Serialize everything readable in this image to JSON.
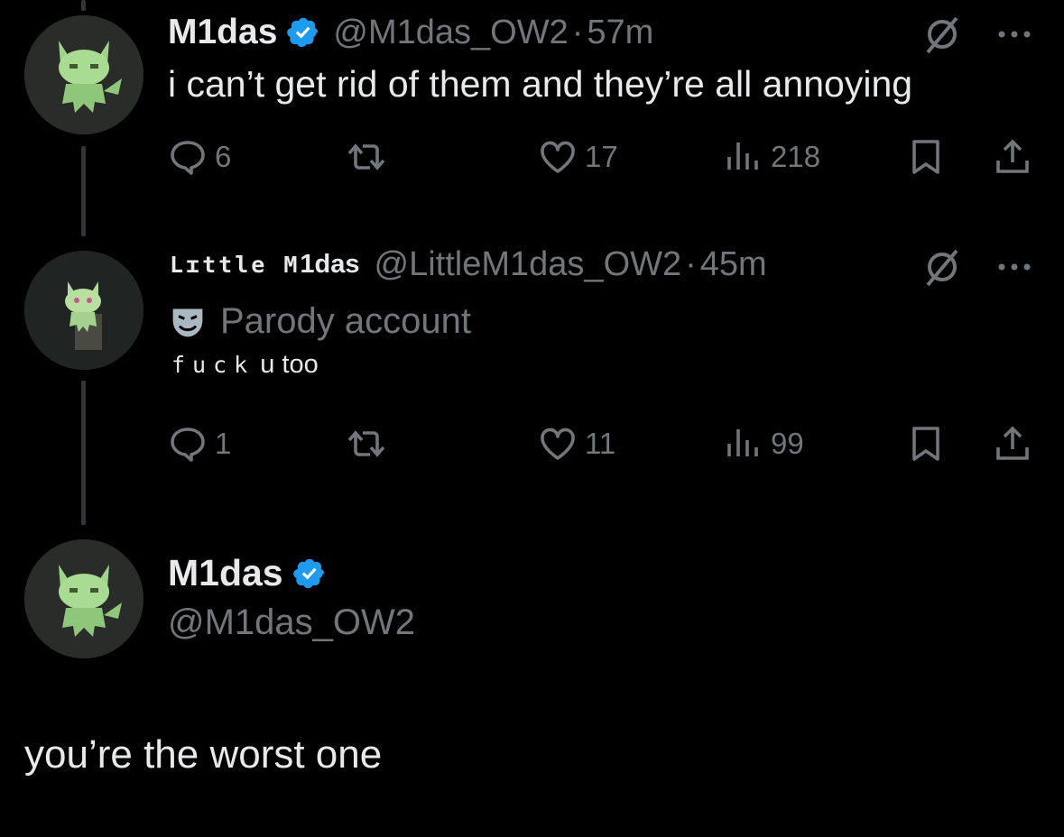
{
  "colors": {
    "background": "#000000",
    "text": "#e7e9ea",
    "muted": "#71767b",
    "verified": "#1d9bf0",
    "thread_line": "#333639"
  },
  "tweet1": {
    "name": "M1das",
    "handle": "@M1das_OW2",
    "separator": "·",
    "time": "57m",
    "verified_icon": "verified-badge-icon",
    "text": "i can’t get rid of them and they’re all annoying",
    "actions": {
      "replies": "6",
      "likes": "17",
      "views": "218"
    }
  },
  "tweet2": {
    "name_stylized": "Lɪttle M",
    "name_bold": "1das",
    "handle": "@LittleM1das_OW2",
    "separator": "·",
    "time": "45m",
    "parody_label": "Parody account",
    "parody_icon": "theater-mask-icon",
    "text_stylized": "fuck",
    "text_plain": "u too",
    "actions": {
      "replies": "1",
      "likes": "11",
      "views": "99"
    }
  },
  "composer": {
    "name": "M1das",
    "handle": "@M1das_OW2",
    "reply_text": "you’re the worst one"
  }
}
